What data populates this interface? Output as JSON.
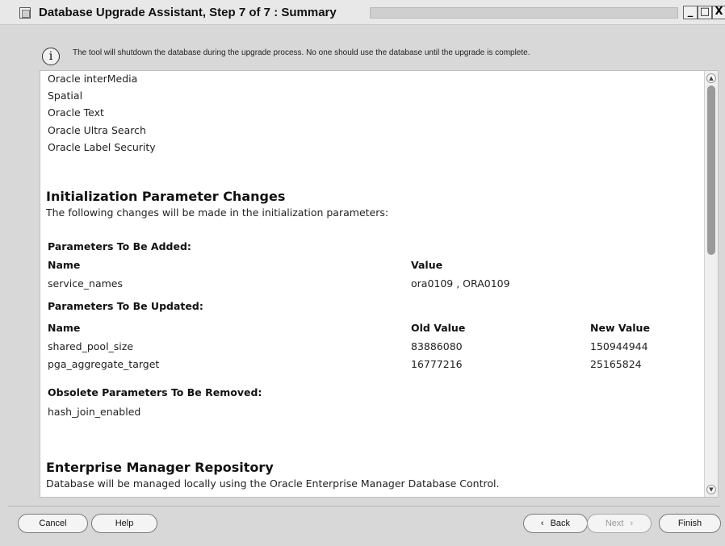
{
  "window": {
    "title": "Database Upgrade Assistant, Step 7 of 7 : Summary",
    "controls": {
      "minimize": "_",
      "maximize": "□",
      "close": "X"
    }
  },
  "info": {
    "icon": "info-icon",
    "glyph": "i",
    "message": "The tool will shutdown the database during the upgrade process. No one should use the database until the upgrade is complete."
  },
  "summary": {
    "components": [
      "Oracle interMedia",
      "Spatial",
      "Oracle Text",
      "Oracle Ultra Search",
      "Oracle Label Security"
    ],
    "init_params": {
      "heading": "Initialization Parameter Changes",
      "description": "The following changes will be made in the initialization parameters:",
      "added": {
        "heading": "Parameters To Be Added:",
        "col_name": "Name",
        "col_value": "Value",
        "rows": [
          {
            "name": "service_names",
            "value": "ora0109 , ORA0109"
          }
        ]
      },
      "updated": {
        "heading": "Parameters To Be Updated:",
        "col_name": "Name",
        "col_old": "Old Value",
        "col_new": "New Value",
        "rows": [
          {
            "name": "shared_pool_size",
            "old": "83886080",
            "new": "150944944"
          },
          {
            "name": "pga_aggregate_target",
            "old": "16777216",
            "new": "25165824"
          }
        ]
      },
      "removed": {
        "heading": "Obsolete Parameters To Be Removed:",
        "rows": [
          "hash_join_enabled"
        ]
      }
    },
    "em": {
      "heading": "Enterprise Manager Repository",
      "description": "Database will be managed locally using the Oracle Enterprise Manager Database Control."
    }
  },
  "buttons": {
    "cancel": "Cancel",
    "help": "Help",
    "back": "Back",
    "next": "Next",
    "finish": "Finish",
    "back_icon": "‹",
    "next_icon": "›"
  },
  "colors": {
    "background": "#d8d8d8",
    "content": "#ffffff",
    "scroll_thumb": "#9a9a9a"
  }
}
